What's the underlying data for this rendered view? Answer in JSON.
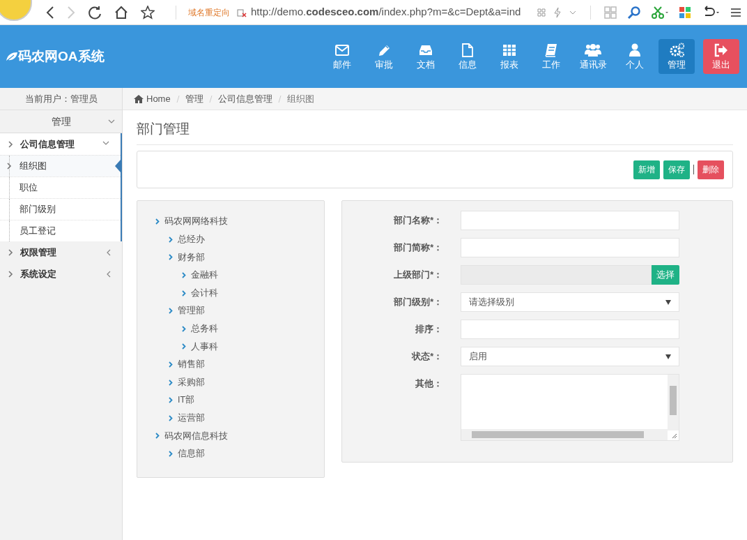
{
  "browser": {
    "redirect_label": "域名重定向",
    "url": "http://demo.**codesceo.com**/index.php?m=&c=Dept&a=ind"
  },
  "header": {
    "logo": "码农网OA系统",
    "nav": [
      {
        "label": "邮件",
        "kind": "mail",
        "selected": false
      },
      {
        "label": "审批",
        "kind": "pencil",
        "selected": false
      },
      {
        "label": "文档",
        "kind": "inbox",
        "selected": false
      },
      {
        "label": "信息",
        "kind": "file",
        "selected": false
      },
      {
        "label": "报表",
        "kind": "table",
        "selected": false
      },
      {
        "label": "工作",
        "kind": "book",
        "selected": false
      },
      {
        "label": "通讯录",
        "kind": "users",
        "selected": false
      },
      {
        "label": "个人",
        "kind": "user",
        "selected": false
      },
      {
        "label": "管理",
        "kind": "gears",
        "selected": true
      },
      {
        "label": "退出",
        "kind": "logout",
        "selected": false
      }
    ]
  },
  "sidebar": {
    "current_user": "当前用户：管理员",
    "section": {
      "label": "管理",
      "expanded": true
    },
    "items": [
      {
        "label": "公司信息管理",
        "expanded": true,
        "children": [
          {
            "label": "组织图",
            "selected": true
          },
          {
            "label": "职位",
            "selected": false
          },
          {
            "label": "部门级别",
            "selected": false
          },
          {
            "label": "员工登记",
            "selected": false
          }
        ]
      },
      {
        "label": "权限管理",
        "expanded": false
      },
      {
        "label": "系统设定",
        "expanded": false
      }
    ]
  },
  "breadcrumb": [
    "Home",
    "管理",
    "公司信息管理",
    "组织图"
  ],
  "page_title": "部门管理",
  "toolbar": [
    {
      "label": "新增",
      "kind": "success"
    },
    {
      "label": "保存",
      "kind": "success"
    },
    {
      "label": "删除",
      "kind": "danger"
    }
  ],
  "tree": [
    {
      "label": "码农网网络科技",
      "children": [
        {
          "label": "总经办"
        },
        {
          "label": "财务部",
          "children": [
            {
              "label": "金融科"
            },
            {
              "label": "会计科"
            }
          ]
        },
        {
          "label": "管理部",
          "children": [
            {
              "label": "总务科"
            },
            {
              "label": "人事科"
            }
          ]
        },
        {
          "label": "销售部"
        },
        {
          "label": "采购部"
        },
        {
          "label": "IT部"
        },
        {
          "label": "运营部"
        }
      ]
    },
    {
      "label": "码农网信息科技",
      "children": [
        {
          "label": "信息部"
        }
      ]
    }
  ],
  "form": [
    {
      "kind": "text",
      "label": "部门名称*："
    },
    {
      "kind": "text",
      "label": "部门简称*："
    },
    {
      "kind": "picker",
      "label": "上级部门*：",
      "button": "选择"
    },
    {
      "kind": "select",
      "label": "部门级别*：",
      "value": "请选择级别"
    },
    {
      "kind": "text",
      "label": "排序："
    },
    {
      "kind": "select",
      "label": "状态*：",
      "value": "启用"
    },
    {
      "kind": "textarea",
      "label": "其他："
    }
  ]
}
